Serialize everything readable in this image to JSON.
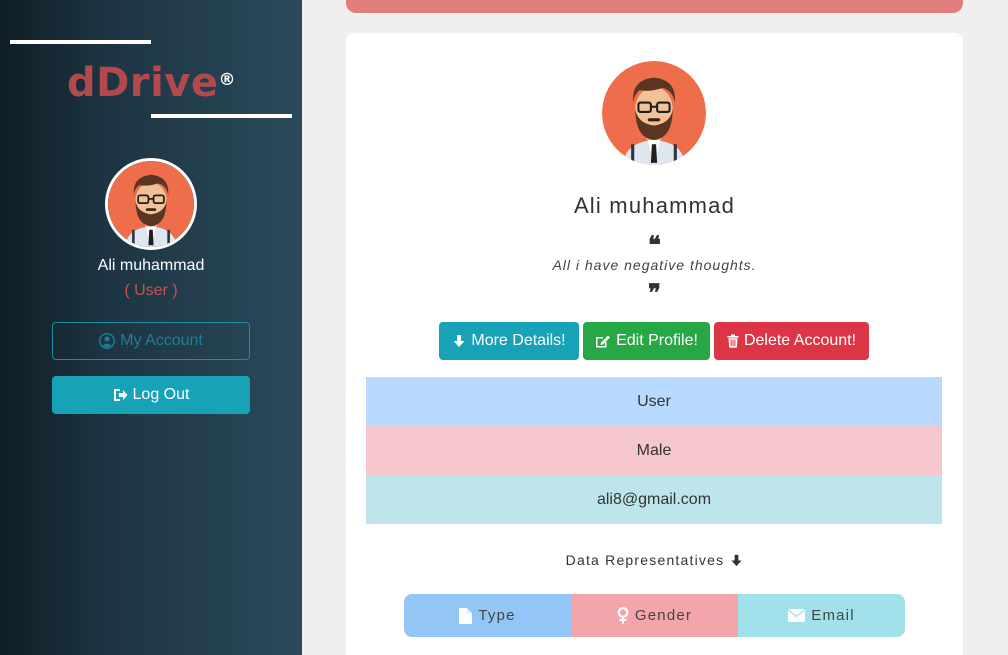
{
  "sidebar": {
    "brand": "dDrive",
    "brand_mark": "®",
    "user_name": "Ali muhammad",
    "user_role": "( User )",
    "my_account_label": "My Account",
    "logout_label": "Log Out",
    "avatar_icon": "avatar-man-beard-glasses",
    "my_account_icon": "user-circle-icon",
    "logout_icon": "sign-out-icon"
  },
  "profile": {
    "name": "Ali muhammad",
    "bio": "All i have negative thoughts.",
    "quote_open": "❝",
    "quote_close": "❞",
    "buttons": {
      "details": "More Details!",
      "edit": "Edit Profile!",
      "delete": "Delete Account!"
    },
    "rows": {
      "role": "User",
      "gender": "Male",
      "email": "ali8@gmail.com"
    },
    "reps_title": "Data Representatives",
    "legend": {
      "type": "Type",
      "gender": "Gender",
      "email": "Email"
    }
  },
  "colors": {
    "brand": "#b24a4d",
    "info": "#17a2b8",
    "success": "#28a745",
    "danger": "#dc3545",
    "alert": "#e27f7d",
    "row_role": "#b8daff",
    "row_gender": "#f5c6cb",
    "row_email": "#bee5eb"
  }
}
